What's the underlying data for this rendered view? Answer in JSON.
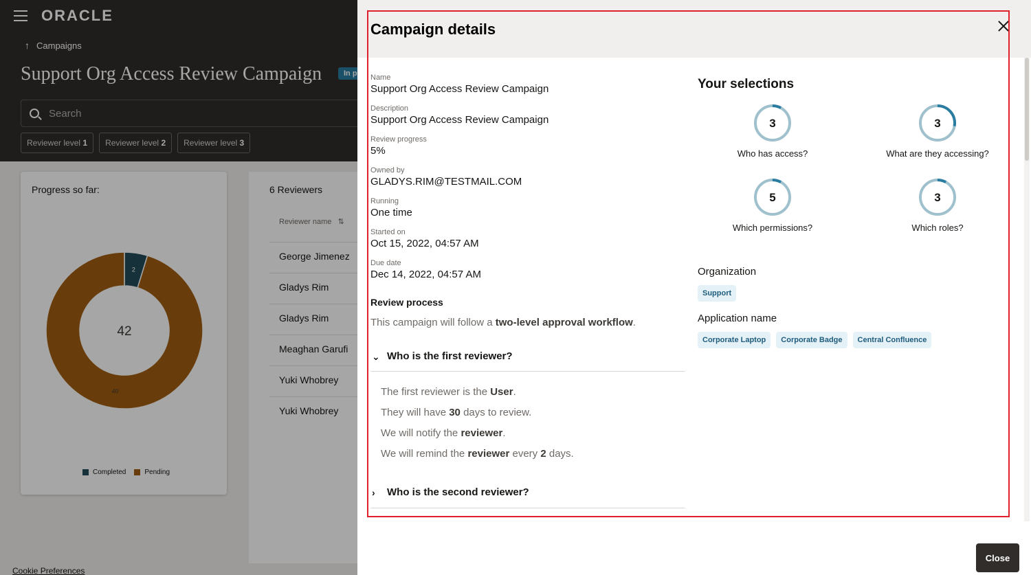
{
  "app": {
    "brand": "ORACLE",
    "breadcrumb": "Campaigns",
    "page_title": "Support Org Access Review Campaign",
    "status_badge": "In p",
    "search_placeholder": "Search",
    "level_tabs": [
      {
        "label": "Reviewer level ",
        "num": "1"
      },
      {
        "label": "Reviewer level ",
        "num": "2"
      },
      {
        "label": "Reviewer level ",
        "num": "3"
      }
    ],
    "cookie_link": "Cookie Preferences"
  },
  "progress": {
    "title": "Progress so far:",
    "total": "42",
    "completed_label": "Completed",
    "pending_label": "Pending",
    "colors": {
      "completed": "#244c59",
      "pending": "#a15f12"
    }
  },
  "chart_data": {
    "type": "pie",
    "categories": [
      "Completed",
      "Pending"
    ],
    "values": [
      2,
      40
    ],
    "center_label": "42",
    "legend": "bottom"
  },
  "reviewers": {
    "count": "6 Reviewers",
    "column": "Reviewer name",
    "names": [
      "George Jimenez",
      "Gladys Rim",
      "Gladys Rim",
      "Meaghan Garufi",
      "Yuki Whobrey",
      "Yuki Whobrey"
    ]
  },
  "drawer": {
    "title": "Campaign details",
    "fields": [
      {
        "label": "Name",
        "value": "Support Org Access Review Campaign"
      },
      {
        "label": "Description",
        "value": "Support Org Access Review Campaign"
      },
      {
        "label": "Review progress",
        "value": "5%"
      },
      {
        "label": "Owned by",
        "value": "GLADYS.RIM@TESTMAIL.COM"
      },
      {
        "label": "Running",
        "value": "One time"
      },
      {
        "label": "Started on",
        "value": "Oct 15, 2022, 04:57 AM"
      },
      {
        "label": "Due date",
        "value": "Dec 14, 2022, 04:57 AM"
      }
    ],
    "review_process": {
      "title": "Review process",
      "intro": "This campaign will follow a ",
      "intro_bold": "two-level approval workflow",
      "intro_end": "."
    },
    "first_reviewer": {
      "heading": "Who is the first reviewer?",
      "line1": {
        "a": "The first reviewer is the ",
        "b": "User",
        "c": "."
      },
      "line2": {
        "a": "They will have ",
        "b": "30",
        "c": " days to review."
      },
      "line3": {
        "a": "We will notify the ",
        "b": "reviewer",
        "c": "."
      },
      "line4": {
        "a": "We will remind the ",
        "b": "reviewer",
        "c": " every ",
        "d": "2",
        "e": " days."
      }
    },
    "second_reviewer": {
      "heading": "Who is the second reviewer?"
    },
    "selections": {
      "title": "Your selections",
      "items": [
        {
          "value": "3",
          "label": "Who has access?",
          "fraction": 0.08
        },
        {
          "value": "3",
          "label": "What are they accessing?",
          "fraction": 0.28
        },
        {
          "value": "5",
          "label": "Which permissions?",
          "fraction": 0.08
        },
        {
          "value": "3",
          "label": "Which roles?",
          "fraction": 0.08
        }
      ],
      "ring_colors": {
        "track": "#9fc0cd",
        "fill": "#2a7da0"
      }
    },
    "organization": {
      "title": "Organization",
      "chips": [
        "Support"
      ]
    },
    "application": {
      "title": "Application name",
      "chips": [
        "Corporate Laptop",
        "Corporate Badge",
        "Central Confluence"
      ]
    },
    "close_button": "Close"
  }
}
